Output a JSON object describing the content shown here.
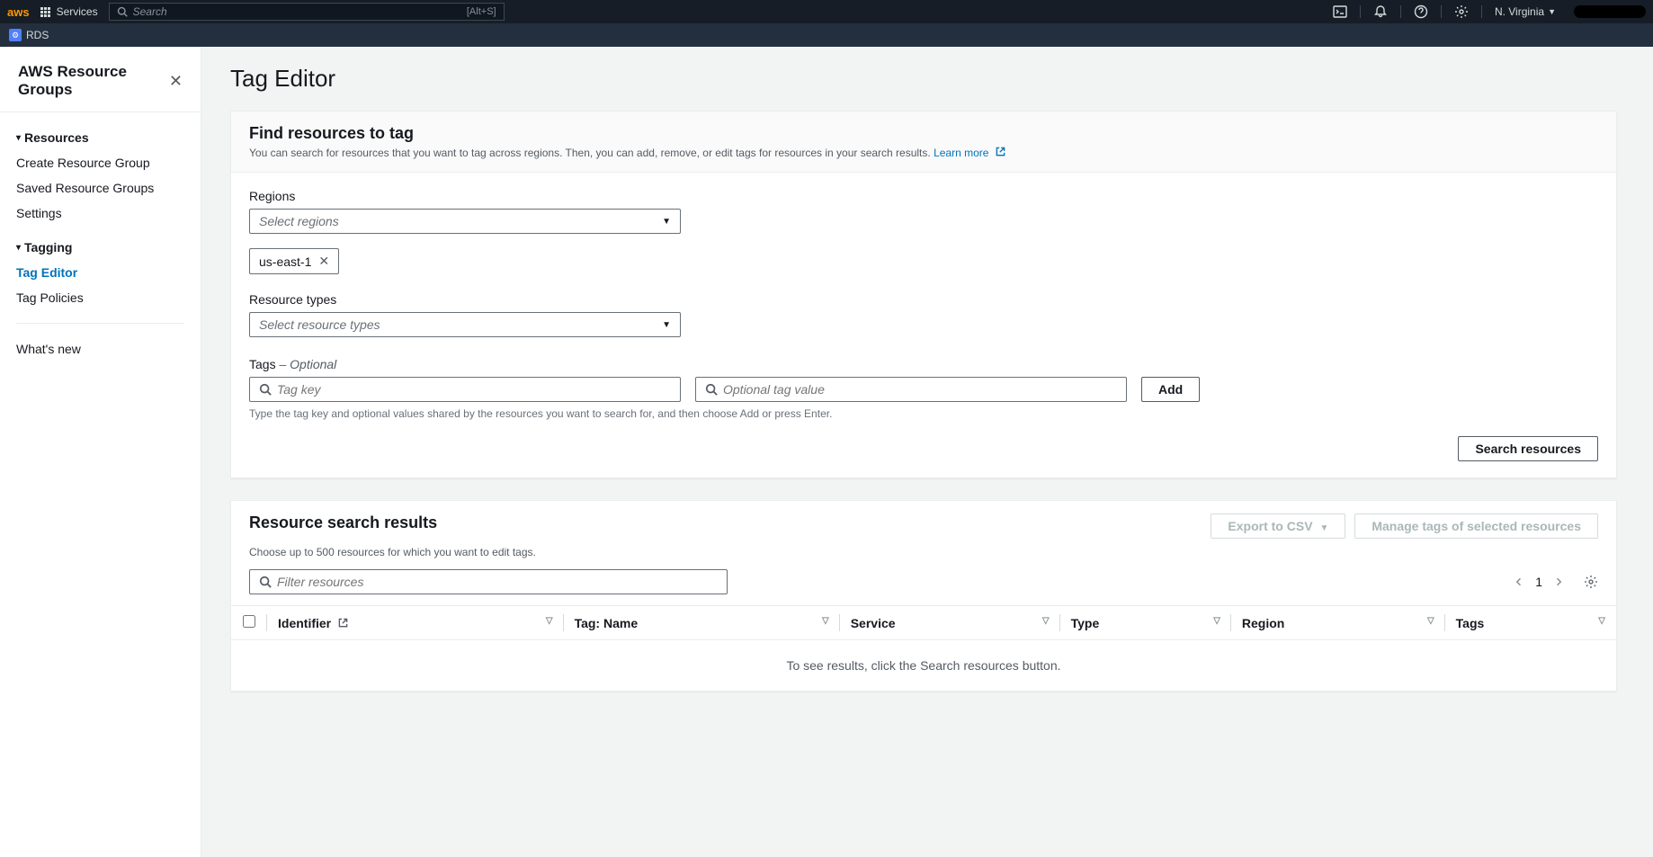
{
  "topnav": {
    "logo": "aws",
    "services_label": "Services",
    "search_placeholder": "Search",
    "search_kbd": "[Alt+S]",
    "region": "N. Virginia"
  },
  "servicebar": {
    "service_badge": "⚙",
    "service_name": "RDS"
  },
  "sidebar": {
    "title": "AWS Resource Groups",
    "sections": [
      {
        "title": "Resources",
        "items": [
          "Create Resource Group",
          "Saved Resource Groups",
          "Settings"
        ]
      },
      {
        "title": "Tagging",
        "items": [
          "Tag Editor",
          "Tag Policies"
        ],
        "active_index": 0
      }
    ],
    "footer_link": "What's new"
  },
  "page": {
    "title": "Tag Editor"
  },
  "find_panel": {
    "title": "Find resources to tag",
    "subtitle_text": "You can search for resources that you want to tag across regions. Then, you can add, remove, or edit tags for resources in your search results.",
    "learn_more": "Learn more",
    "regions_label": "Regions",
    "regions_placeholder": "Select regions",
    "region_chip": "us-east-1",
    "resource_types_label": "Resource types",
    "resource_types_placeholder": "Select resource types",
    "tags_label": "Tags",
    "tags_optional": "– Optional",
    "tag_key_placeholder": "Tag key",
    "tag_value_placeholder": "Optional tag value",
    "add_button": "Add",
    "tags_hint": "Type the tag key and optional values shared by the resources you want to search for, and then choose Add or press Enter.",
    "search_button": "Search resources"
  },
  "results_panel": {
    "title": "Resource search results",
    "export_button": "Export to CSV",
    "manage_button": "Manage tags of selected resources",
    "subtitle": "Choose up to 500 resources for which you want to edit tags.",
    "filter_placeholder": "Filter resources",
    "page_number": "1",
    "columns": [
      "Identifier",
      "Tag: Name",
      "Service",
      "Type",
      "Region",
      "Tags"
    ],
    "empty_message": "To see results, click the Search resources button."
  }
}
